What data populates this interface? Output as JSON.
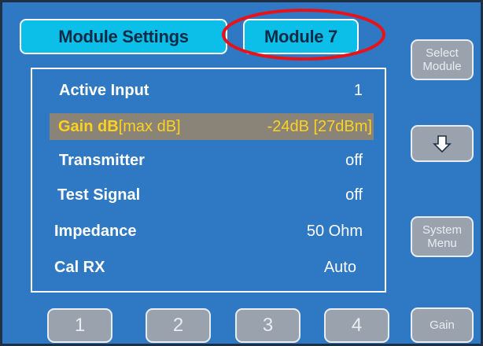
{
  "tabs": {
    "settings_label": "Module Settings",
    "module_label": "Module 7"
  },
  "colors": {
    "background": "#2f78c3",
    "tab_fill": "#0bbfe9",
    "selected_row": "#8a8378",
    "selected_text": "#ffd21f",
    "button_fill": "#9aa3ad",
    "highlight_circle": "#e8131a"
  },
  "settings": [
    {
      "label": "Active Input",
      "value": "1"
    },
    {
      "label": "Gain dB",
      "unit": "[max dB]",
      "value": "-24dB [27dBm]",
      "selected": true
    },
    {
      "label": "Transmitter",
      "value": "off"
    },
    {
      "label": "Test Signal",
      "value": "off"
    },
    {
      "label": "Impedance",
      "value": "50 Ohm"
    },
    {
      "label": "Cal RX",
      "value": "Auto"
    }
  ],
  "side_buttons": {
    "select_module_line1": "Select",
    "select_module_line2": "Module",
    "down_icon": "down-arrow-icon",
    "system_menu_line1": "System",
    "system_menu_line2": "Menu",
    "gain": "Gain"
  },
  "number_buttons": [
    "1",
    "2",
    "3",
    "4"
  ]
}
